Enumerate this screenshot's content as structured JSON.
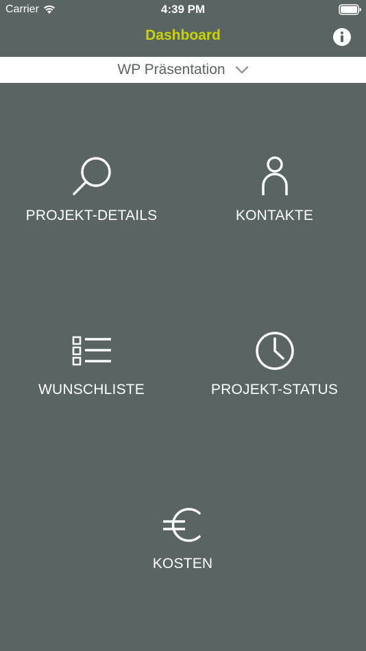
{
  "status_bar": {
    "carrier": "Carrier",
    "time": "4:39 PM"
  },
  "nav": {
    "title": "Dashboard",
    "title_color": "#c8d400",
    "info_icon": "info-icon"
  },
  "project_selector": {
    "selected": "WP Präsentation",
    "chevron_icon": "chevron-down-icon"
  },
  "tiles": [
    {
      "label": "PROJEKT-DETAILS",
      "icon": "search-icon"
    },
    {
      "label": "KONTAKTE",
      "icon": "person-icon"
    },
    {
      "label": "WUNSCHLISTE",
      "icon": "checklist-icon"
    },
    {
      "label": "PROJEKT-STATUS",
      "icon": "clock-icon"
    },
    {
      "label": "KOSTEN",
      "icon": "euro-icon"
    }
  ],
  "colors": {
    "background": "#5a6563",
    "accent": "#c8d400",
    "foreground": "#ffffff"
  }
}
